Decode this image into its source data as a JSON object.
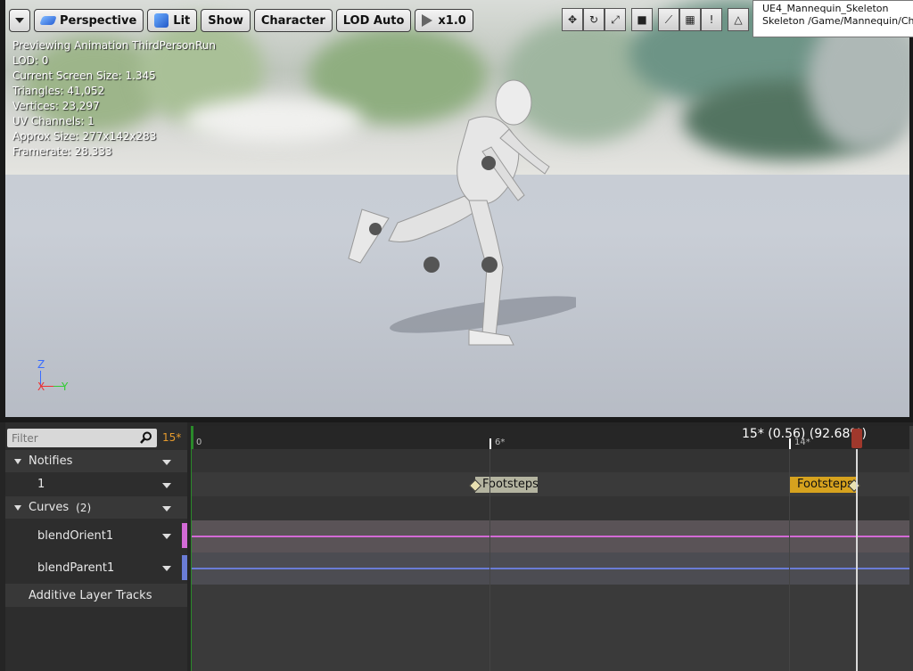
{
  "toolbar": {
    "menu_button": "",
    "perspective": "Perspective",
    "lit": "Lit",
    "show": "Show",
    "character": "Character",
    "lod": "LOD Auto",
    "speed": "x1.0"
  },
  "tooltip": {
    "line1": "UE4_Mannequin_Skeleton",
    "line2": "Skeleton /Game/Mannequin/Character"
  },
  "stats": {
    "previewing": "Previewing Animation ThirdPersonRun",
    "lod": "LOD: 0",
    "screen_size": "Current Screen Size: 1.345",
    "triangles": "Triangles: 41,052",
    "vertices": "Vertices: 23,297",
    "uv_channels": "UV Channels: 1",
    "approx_size": "Approx Size: 277x142x283",
    "framerate": "Framerate: 28.333"
  },
  "axis": {
    "z": "Z",
    "x": "X",
    "y": "Y"
  },
  "filter": {
    "placeholder": "Filter",
    "frame": "15*"
  },
  "tracks": {
    "notifies": "Notifies",
    "notify_track": "1",
    "curves": "Curves",
    "curves_count": "(2)",
    "curve1": "blendOrient1",
    "curve2": "blendParent1",
    "additive": "Additive Layer Tracks"
  },
  "timeline": {
    "tick0": "0",
    "tick6": "6*",
    "tick14": "14*",
    "scrub_label": "15* (0.56) (92.68%)",
    "notify1": "Footsteps",
    "notify2": "Footsteps"
  },
  "colors": {
    "curve1": "#d36ad6",
    "curve2": "#6a7cd6",
    "notify1_bg": "#b4b4a0",
    "notify2_bg": "#d6a21e",
    "frame_text": "#e59a2d"
  }
}
